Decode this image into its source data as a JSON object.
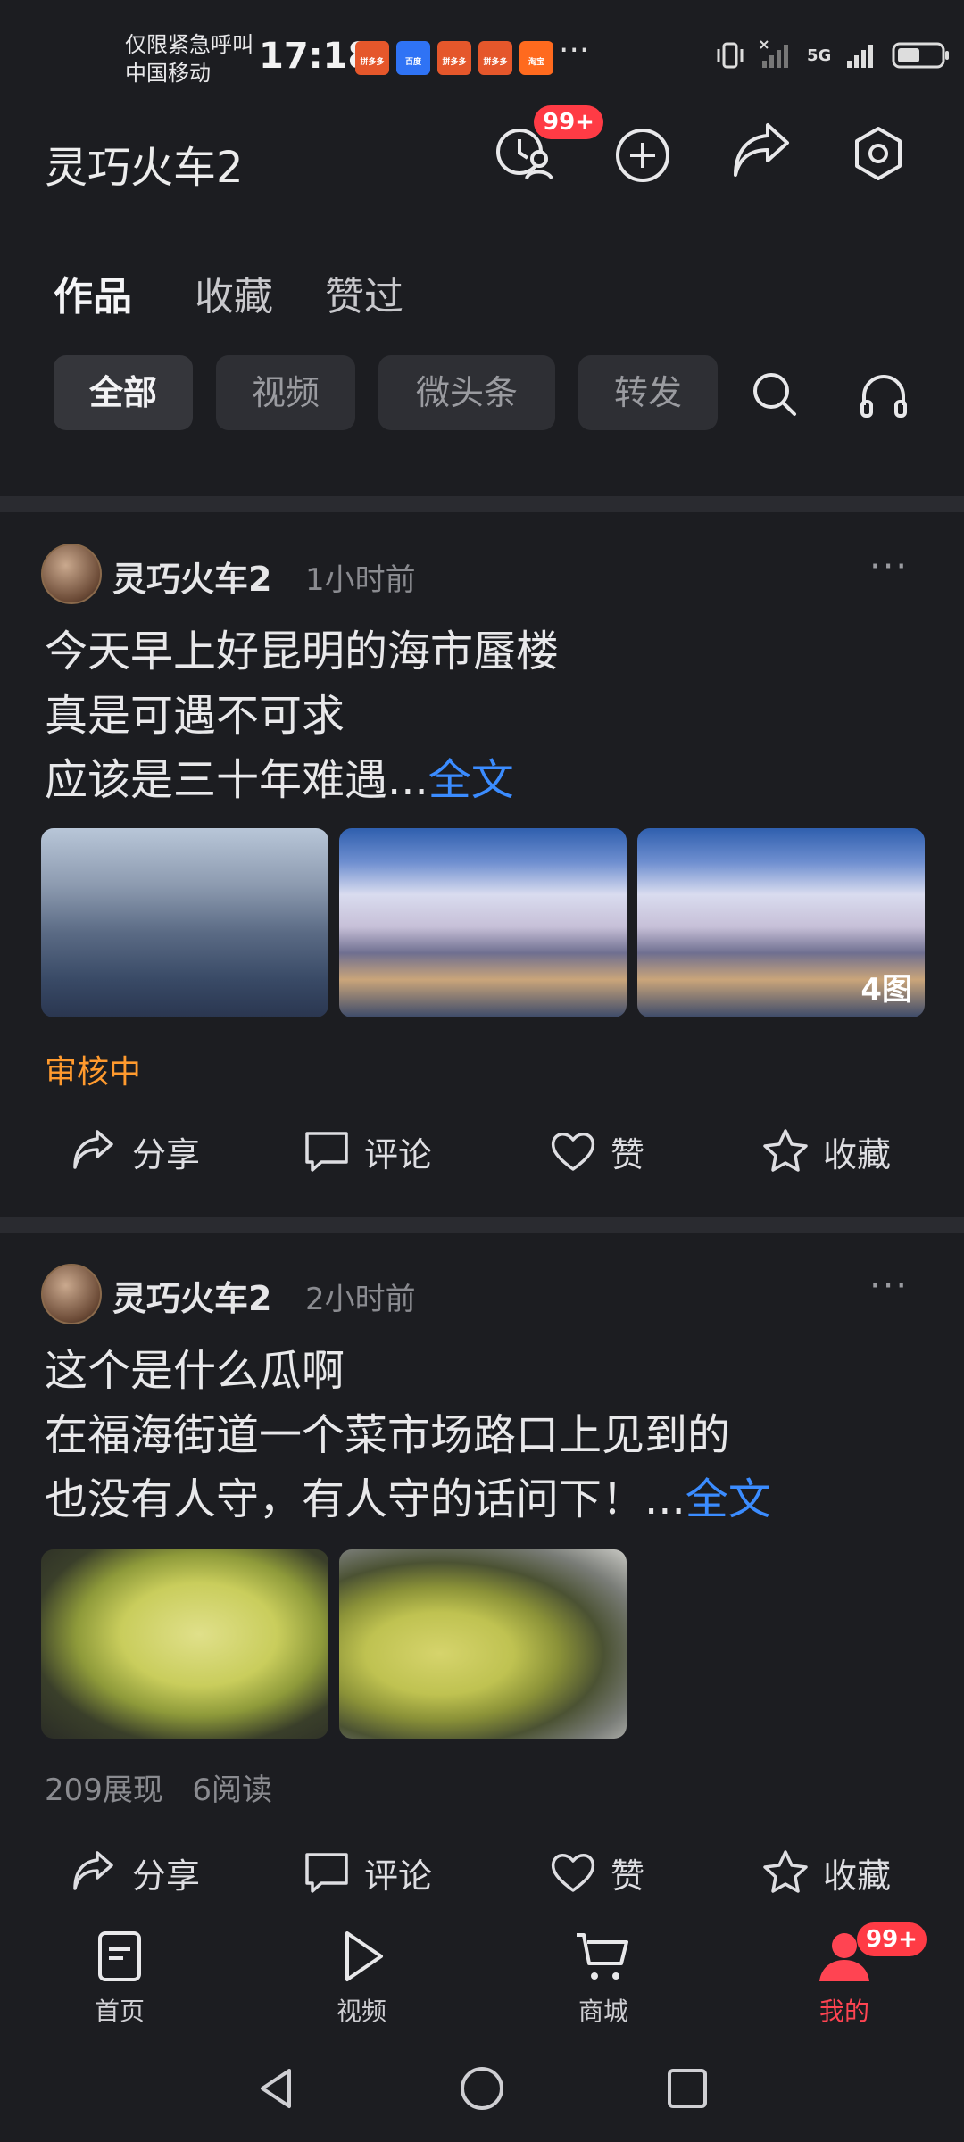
{
  "status_bar": {
    "carrier_line1": "仅限紧急呼叫",
    "carrier_line2": "中国移动",
    "time": "17:18",
    "app_icons": [
      "拼多多",
      "百度",
      "拼多多",
      "拼多多",
      "淘宝"
    ],
    "more": "···",
    "network": "5G"
  },
  "header": {
    "title": "灵巧火车2",
    "badge": "99+",
    "icons": [
      "visitor-icon",
      "add-icon",
      "share-icon",
      "settings-icon"
    ]
  },
  "profile_tabs": [
    "作品",
    "收藏",
    "赞过"
  ],
  "filter_chips": [
    "全部",
    "视频",
    "微头条",
    "转发"
  ],
  "posts": [
    {
      "author": "灵巧火车2",
      "time": "1小时前",
      "lines": [
        "今天早上好昆明的海市蜃楼",
        "真是可遇不可求",
        "应该是三十年难遇..."
      ],
      "full_text": "全文",
      "image_count_label": "4图",
      "status": "审核中",
      "actions": [
        "分享",
        "评论",
        "赞",
        "收藏"
      ]
    },
    {
      "author": "灵巧火车2",
      "time": "2小时前",
      "lines": [
        "这个是什么瓜啊",
        "在福海街道一个菜市场路口上见到的",
        "也没有人守，有人守的话问下！..."
      ],
      "full_text": "全文",
      "impressions": "209展现",
      "reads": "6阅读",
      "actions": [
        "分享",
        "评论",
        "赞",
        "收藏"
      ]
    }
  ],
  "bottom_nav": {
    "items": [
      "首页",
      "视频",
      "商城",
      "我的"
    ],
    "badge": "99+",
    "active_color": "#ff4452"
  }
}
